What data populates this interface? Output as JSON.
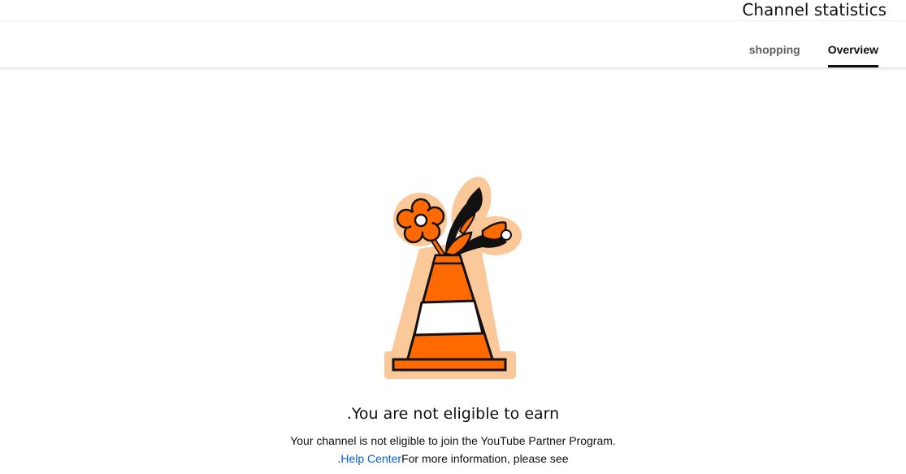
{
  "header": {
    "title": "Channel statistics",
    "tabs": [
      {
        "label": "shopping",
        "active": false
      },
      {
        "label": "Overview",
        "active": true
      }
    ]
  },
  "empty_state": {
    "illustration": "traffic-cone-with-flowers-icon",
    "heading": ".You are not eligible to earn",
    "description": "Your channel is not eligible to join the YouTube Partner Program.",
    "help_prefix": ".",
    "help_link": "Help Center",
    "help_suffix": "For more information, please see"
  },
  "colors": {
    "accent_orange": "#ff6a00",
    "halo_peach": "#fbc89a",
    "link_blue": "#065fd4",
    "tab_underline": "#0f0f0f"
  }
}
